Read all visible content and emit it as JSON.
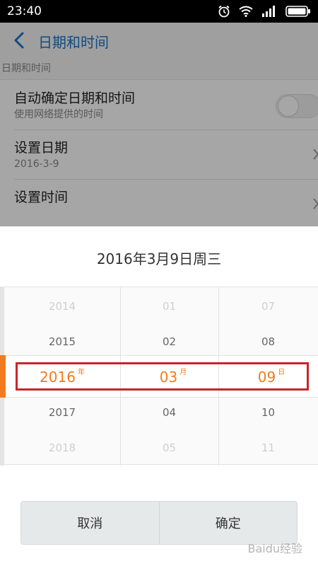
{
  "status_bar": {
    "time": "23:40",
    "icons": [
      "alarm-icon",
      "wifi-icon",
      "signal-icon",
      "battery-icon"
    ]
  },
  "settings_screen": {
    "back_icon": "chevron-left-icon",
    "title": "日期和时间",
    "section_label": "日期和时间",
    "items": [
      {
        "title": "自动确定日期和时间",
        "subtitle": "使用网络提供的时间",
        "control": "toggle-off"
      },
      {
        "title": "设置日期",
        "subtitle": "2016-3-9",
        "control": "chevron-right-icon"
      },
      {
        "title": "设置时间",
        "subtitle": "",
        "control": "chevron-right-icon"
      }
    ]
  },
  "date_picker": {
    "title": "2016年3月9日周三",
    "columns": {
      "year": {
        "items": [
          "2014",
          "2015",
          "2016",
          "2017",
          "2018"
        ],
        "selected_index": 2,
        "unit": "年"
      },
      "month": {
        "items": [
          "01",
          "02",
          "03",
          "04",
          "05"
        ],
        "selected_index": 2,
        "unit": "月"
      },
      "day": {
        "items": [
          "07",
          "08",
          "09",
          "10",
          "11"
        ],
        "selected_index": 2,
        "unit": "日"
      }
    },
    "accent_color": "#f37b1d",
    "highlight_color": "#c8242b",
    "buttons": {
      "cancel": "取消",
      "confirm": "确定"
    }
  },
  "watermark": "Baidu经验"
}
